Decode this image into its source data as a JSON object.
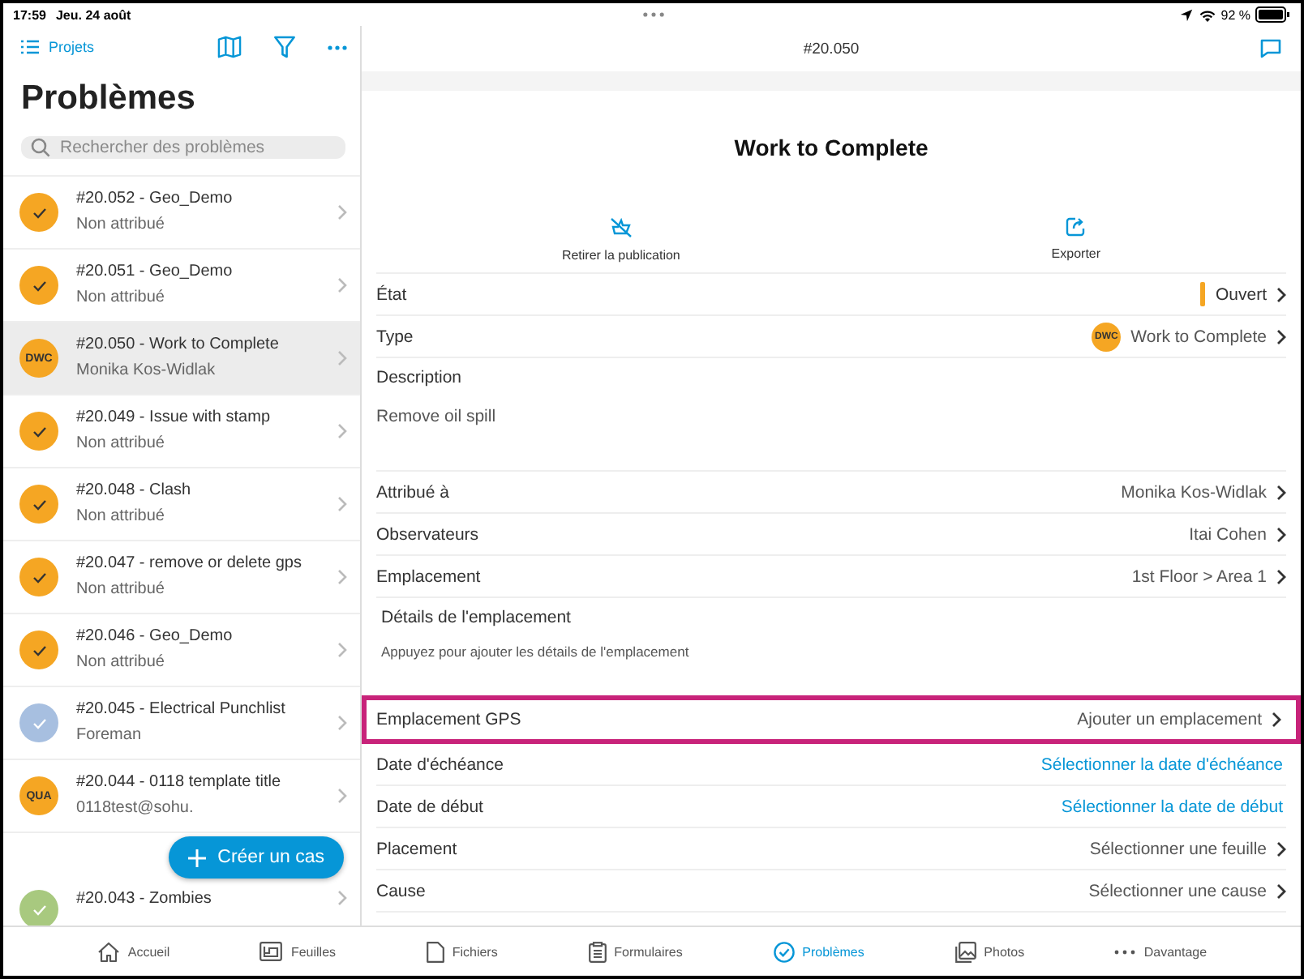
{
  "status_bar": {
    "time": "17:59",
    "date": "Jeu. 24 août",
    "battery": "92 %"
  },
  "sidebar": {
    "back_link": "Projets",
    "title": "Problèmes",
    "search": {
      "placeholder": "Rechercher des problèmes"
    },
    "items": [
      {
        "title": "#20.052 - Geo_Demo",
        "subtitle": "Non attribué",
        "avatar": {
          "kind": "check",
          "color": "#f5a623"
        },
        "selected": false
      },
      {
        "title": "#20.051 - Geo_Demo",
        "subtitle": "Non attribué",
        "avatar": {
          "kind": "check",
          "color": "#f5a623"
        },
        "selected": false
      },
      {
        "title": "#20.050 - Work to Complete",
        "subtitle": "Monika Kos-Widlak",
        "avatar": {
          "kind": "initials",
          "text": "DWC",
          "color": "#f5a623"
        },
        "selected": true
      },
      {
        "title": "#20.049 - Issue with stamp",
        "subtitle": "Non attribué",
        "avatar": {
          "kind": "check",
          "color": "#f5a623"
        },
        "selected": false
      },
      {
        "title": "#20.048 - Clash",
        "subtitle": "Non attribué",
        "avatar": {
          "kind": "check",
          "color": "#f5a623"
        },
        "selected": false
      },
      {
        "title": "#20.047 - remove or delete gps",
        "subtitle": "Non attribué",
        "avatar": {
          "kind": "check",
          "color": "#f5a623"
        },
        "selected": false
      },
      {
        "title": "#20.046 - Geo_Demo",
        "subtitle": "Non attribué",
        "avatar": {
          "kind": "check",
          "color": "#f5a623"
        },
        "selected": false
      },
      {
        "title": "#20.045 - Electrical Punchlist",
        "subtitle": "Foreman",
        "avatar": {
          "kind": "check",
          "color": "#a7bfe0"
        },
        "selected": false
      },
      {
        "title": "#20.044 - 0118 template title",
        "subtitle": "0118test@sohu.",
        "avatar": {
          "kind": "initials",
          "text": "QUA",
          "color": "#f5a623"
        },
        "selected": false
      },
      {
        "title": "#20.043 - Zombies",
        "avatar": {
          "kind": "check",
          "color": "#a8c97f"
        },
        "selected": false
      }
    ],
    "create_button": "Créer un cas"
  },
  "detail": {
    "header": "#20.050",
    "title": "Work to Complete",
    "actions": [
      {
        "label": "Retirer la publication"
      },
      {
        "label": "Exporter"
      }
    ],
    "rows": [
      {
        "kind": "status",
        "label": "État",
        "value": "Ouvert",
        "color": "#f5a623",
        "highlighted": false
      },
      {
        "kind": "type",
        "label": "Type",
        "badge": "DWC",
        "value": "Work to Complete",
        "highlighted": false
      },
      {
        "kind": "description",
        "label": "Description",
        "value": "Remove oil spill",
        "highlighted": false
      },
      {
        "kind": "value",
        "label": "Attribué à",
        "value": "Monika Kos-Widlak",
        "highlighted": false
      },
      {
        "kind": "value",
        "label": "Observateurs",
        "value": "Itai Cohen",
        "highlighted": false
      },
      {
        "kind": "value",
        "label": "Emplacement",
        "value": "1st Floor > Area 1",
        "highlighted": false
      },
      {
        "kind": "hint",
        "label": "Détails de l'emplacement",
        "value": "Appuyez pour ajouter les détails de l'emplacement",
        "highlighted": false
      },
      {
        "kind": "value",
        "label": "Emplacement GPS",
        "value": "Ajouter un emplacement",
        "highlighted": true
      },
      {
        "kind": "link",
        "label": "Date d'échéance",
        "value": "Sélectionner la date d'échéance",
        "highlighted": false
      },
      {
        "kind": "link",
        "label": "Date de début",
        "value": "Sélectionner la date de début",
        "highlighted": false
      },
      {
        "kind": "value",
        "label": "Placement",
        "value": "Sélectionner une feuille",
        "highlighted": false
      },
      {
        "kind": "value",
        "label": "Cause",
        "value": "Sélectionner une cause",
        "highlighted": false
      }
    ]
  },
  "tab_bar": [
    {
      "label": "Accueil",
      "selected": false
    },
    {
      "label": "Feuilles",
      "selected": false
    },
    {
      "label": "Fichiers",
      "selected": false
    },
    {
      "label": "Formulaires",
      "selected": false
    },
    {
      "label": "Problèmes",
      "selected": true
    },
    {
      "label": "Photos",
      "selected": false
    },
    {
      "label": "Davantage",
      "selected": false
    }
  ]
}
